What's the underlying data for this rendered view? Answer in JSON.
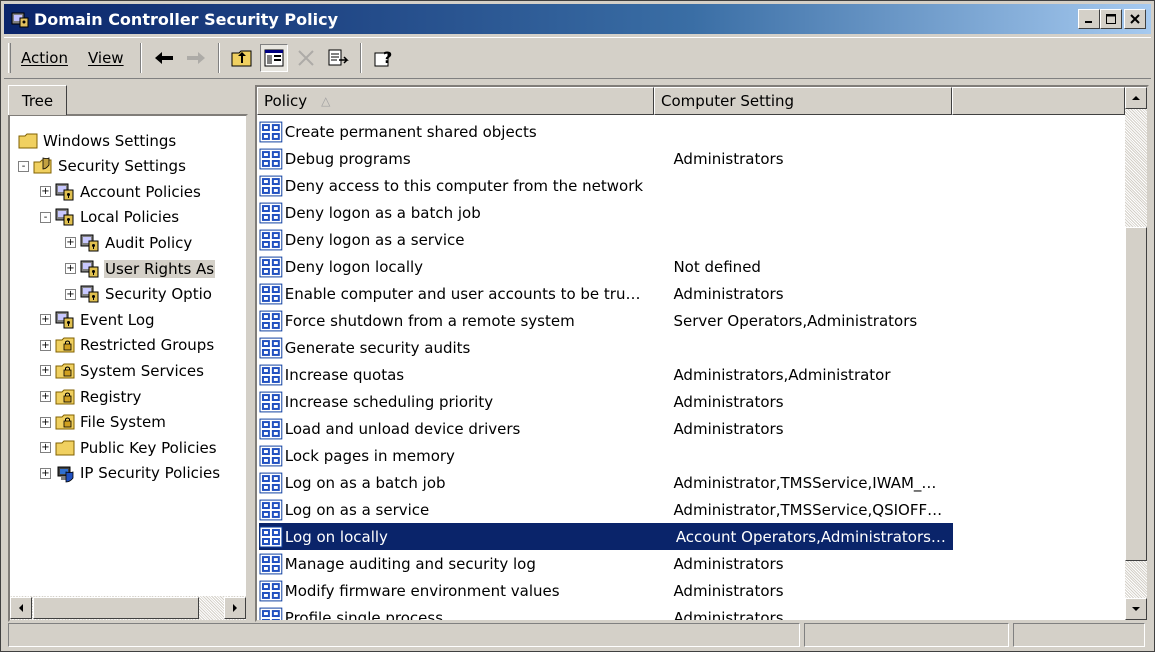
{
  "window": {
    "title": "Domain Controller Security Policy"
  },
  "menu": {
    "action": "Action",
    "view": "View"
  },
  "tree": {
    "tab_label": "Tree",
    "items": [
      {
        "label": "Windows Settings",
        "icon": "folder-icon",
        "level": 0,
        "expander": ""
      },
      {
        "label": "Security Settings",
        "icon": "security-folder-icon",
        "level": 0,
        "expander": "-"
      },
      {
        "label": "Account Policies",
        "icon": "policy-icon",
        "level": 1,
        "expander": "+"
      },
      {
        "label": "Local Policies",
        "icon": "policy-icon",
        "level": 1,
        "expander": "-"
      },
      {
        "label": "Audit Policy",
        "icon": "policy-icon",
        "level": 2,
        "expander": "+"
      },
      {
        "label": "User Rights As",
        "icon": "policy-icon",
        "level": 2,
        "expander": "+",
        "selected": true
      },
      {
        "label": "Security Optio",
        "icon": "policy-icon",
        "level": 2,
        "expander": "+"
      },
      {
        "label": "Event Log",
        "icon": "policy-icon",
        "level": 1,
        "expander": "+"
      },
      {
        "label": "Restricted Groups",
        "icon": "secure-folder-icon",
        "level": 1,
        "expander": "+"
      },
      {
        "label": "System Services",
        "icon": "secure-folder-icon",
        "level": 1,
        "expander": "+"
      },
      {
        "label": "Registry",
        "icon": "secure-folder-icon",
        "level": 1,
        "expander": "+"
      },
      {
        "label": "File System",
        "icon": "secure-folder-icon",
        "level": 1,
        "expander": "+"
      },
      {
        "label": "Public Key Policies",
        "icon": "folder-icon",
        "level": 1,
        "expander": "+"
      },
      {
        "label": "IP Security Policies",
        "icon": "ip-security-icon",
        "level": 1,
        "expander": "+"
      }
    ]
  },
  "list": {
    "columns": [
      "Policy",
      "Computer Setting",
      ""
    ],
    "sort_indicator": "△",
    "rows": [
      {
        "policy": "Create permanent shared objects",
        "setting": ""
      },
      {
        "policy": "Debug programs",
        "setting": "Administrators"
      },
      {
        "policy": "Deny access to this computer from the network",
        "setting": ""
      },
      {
        "policy": "Deny logon as a batch job",
        "setting": ""
      },
      {
        "policy": "Deny logon as a service",
        "setting": ""
      },
      {
        "policy": "Deny logon locally",
        "setting": "Not defined"
      },
      {
        "policy": "Enable computer and user accounts to be tru…",
        "setting": "Administrators"
      },
      {
        "policy": "Force shutdown from a remote system",
        "setting": "Server Operators,Administrators"
      },
      {
        "policy": "Generate security audits",
        "setting": ""
      },
      {
        "policy": "Increase quotas",
        "setting": "Administrators,Administrator"
      },
      {
        "policy": "Increase scheduling priority",
        "setting": "Administrators"
      },
      {
        "policy": "Load and unload device drivers",
        "setting": "Administrators"
      },
      {
        "policy": "Lock pages in memory",
        "setting": ""
      },
      {
        "policy": "Log on as a batch job",
        "setting": "Administrator,TMSService,IWAM_…"
      },
      {
        "policy": "Log on as a service",
        "setting": "Administrator,TMSService,QSIOFF…"
      },
      {
        "policy": "Log on locally",
        "setting": "Account Operators,Administrators…",
        "selected": true
      },
      {
        "policy": "Manage auditing and security log",
        "setting": "Administrators"
      },
      {
        "policy": "Modify firmware environment values",
        "setting": "Administrators"
      },
      {
        "policy": "Profile single process",
        "setting": "Administrators"
      }
    ]
  },
  "colors": {
    "title_active": "#0a246a",
    "selection": "#0a246a",
    "face": "#d4d0c8"
  }
}
